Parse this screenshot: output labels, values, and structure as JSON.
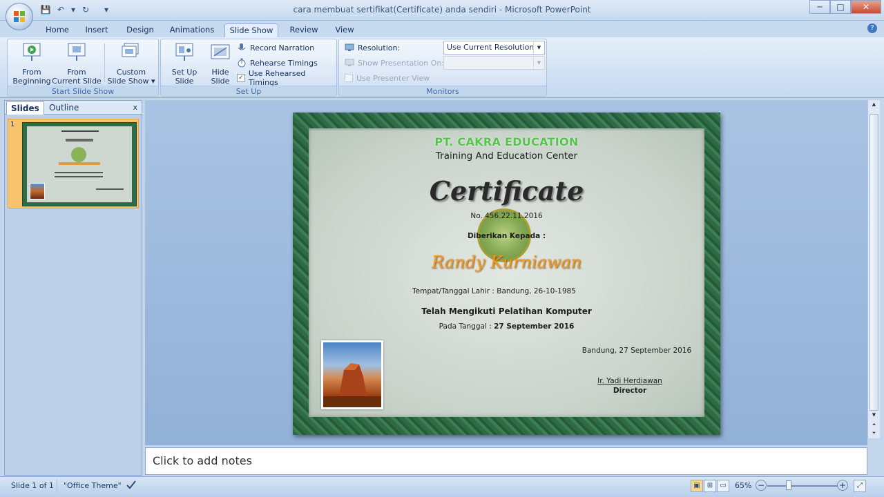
{
  "window": {
    "title": "cara membuat sertifikat(Certificate) anda sendiri - Microsoft PowerPoint",
    "minimize": "─",
    "maximize": "□",
    "close": "✕"
  },
  "qat": {
    "save": "💾",
    "undo": "↶",
    "undo_dd": "▾",
    "redo": "↻",
    "customize": "▾"
  },
  "tabs": [
    {
      "label": "Home"
    },
    {
      "label": "Insert"
    },
    {
      "label": "Design"
    },
    {
      "label": "Animations"
    },
    {
      "label": "Slide Show",
      "active": true
    },
    {
      "label": "Review"
    },
    {
      "label": "View"
    }
  ],
  "help": "?",
  "ribbon": {
    "start": {
      "group_label": "Start Slide Show",
      "from_beginning": "From\nBeginning",
      "from_current": "From\nCurrent Slide",
      "custom": "Custom\nSlide Show ▾"
    },
    "setup": {
      "group_label": "Set Up",
      "setup_show": "Set Up\nSlide Show",
      "hide_slide": "Hide\nSlide",
      "record_narration": "Record Narration",
      "rehearse_timings": "Rehearse Timings",
      "use_rehearsed": "Use Rehearsed Timings",
      "use_rehearsed_checked": "✓"
    },
    "monitors": {
      "group_label": "Monitors",
      "resolution_label": "Resolution:",
      "resolution_value": "Use Current Resolution",
      "show_on_label": "Show Presentation On:",
      "show_on_value": "",
      "presenter_view": "Use Presenter View"
    }
  },
  "left_pane": {
    "tab_slides": "Slides",
    "tab_outline": "Outline",
    "close": "x",
    "slide_number": "1"
  },
  "certificate": {
    "company": "PT. CAKRA EDUCATION",
    "subtitle": "Training And Education Center",
    "title": "Certificate",
    "number": "No. 456.22.11.2016",
    "given_to": "Diberikan Kepada :",
    "name": "Randy Kurniawan",
    "birth": "Tempat/Tanggal Lahir : Bandung, 26-10-1985",
    "course": "Telah Mengikuti Pelatihan Komputer",
    "date_prefix": "Pada Tanggal :",
    "date_value": "27 September 2016",
    "place_date": "Bandung, 27 September 2016",
    "signer": "Ir. Yadi Herdiawan",
    "signer_title": "Director"
  },
  "notes": {
    "placeholder": "Click to add notes"
  },
  "status": {
    "slide": "Slide 1 of 1",
    "theme": "\"Office Theme\"",
    "zoom": "65%",
    "zoom_out": "−",
    "zoom_in": "+"
  }
}
